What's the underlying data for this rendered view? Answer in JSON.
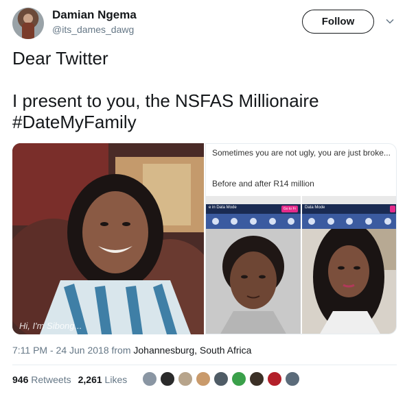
{
  "user": {
    "display_name": "Damian Ngema",
    "handle": "@its_dames_dawg",
    "follow_label": "Follow"
  },
  "tweet": {
    "text_line1": "Dear Twitter",
    "text_line2": "I present to you, the NSFAS Millionaire\n#DateMyFamily"
  },
  "media": {
    "left_subtitle": "Hi, I'm Sibong...",
    "caption_top": "Sometimes you are not ugly, you are just broke...",
    "caption_bottom": "Before and after R14 million",
    "data_mode_label_1": "e in Data Mode",
    "data_mode_label_2": "Data Mode",
    "go_to_free": "Go to Fr"
  },
  "meta": {
    "time": "7:11 PM - 24 Jun 2018",
    "from": "from",
    "location": "Johannesburg, South Africa"
  },
  "stats": {
    "retweets_count": "946",
    "retweets_label": "Retweets",
    "likes_count": "2,261",
    "likes_label": "Likes"
  },
  "icons": {
    "chevron": "chevron-down-icon"
  },
  "colors": {
    "facebook_blue": "#3b5ba0",
    "text_primary": "#14171a",
    "text_secondary": "#657786"
  }
}
